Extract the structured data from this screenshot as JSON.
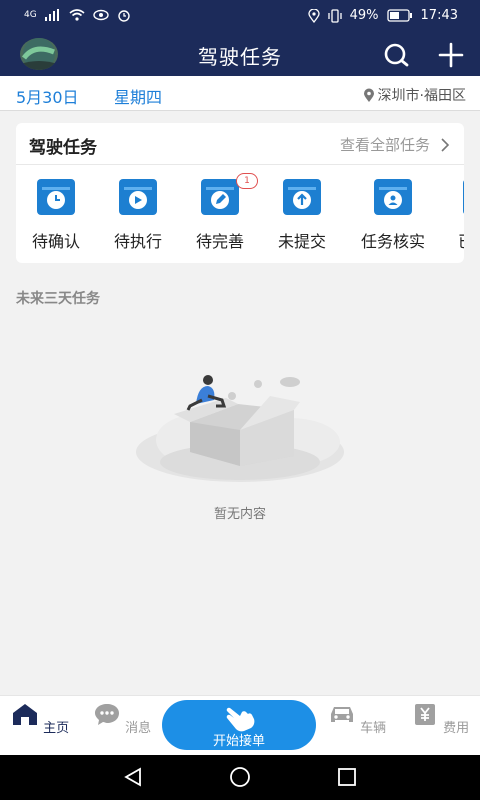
{
  "status_bar": {
    "network": "4G",
    "battery_percent": "49%",
    "time": "17:43"
  },
  "app_bar": {
    "title": "驾驶任务",
    "search_icon": "search-icon",
    "add_icon": "plus-icon"
  },
  "date_bar": {
    "date": "5月30日",
    "weekday": "星期四",
    "location": "深圳市·福田区"
  },
  "task_card": {
    "title": "驾驶任务",
    "view_all": "查看全部任务",
    "items": [
      {
        "label": "待确认",
        "icon": "clock-icon",
        "badge": ""
      },
      {
        "label": "待执行",
        "icon": "play-icon",
        "badge": ""
      },
      {
        "label": "待完善",
        "icon": "edit-icon",
        "badge": "1"
      },
      {
        "label": "未提交",
        "icon": "upload-icon",
        "badge": ""
      },
      {
        "label": "任务核实",
        "icon": "user-verify-icon",
        "badge": ""
      },
      {
        "label": "已",
        "icon": "partial-icon",
        "badge": ""
      }
    ]
  },
  "upcoming": {
    "title": "未来三天任务",
    "empty_text": "暂无内容"
  },
  "tab_bar": {
    "home": "主页",
    "messages": "消息",
    "start": "开始接单",
    "vehicles": "车辆",
    "fees": "费用"
  },
  "colors": {
    "header": "#1c2b5a",
    "accent": "#1d8fe6",
    "badge": "#e05050"
  }
}
